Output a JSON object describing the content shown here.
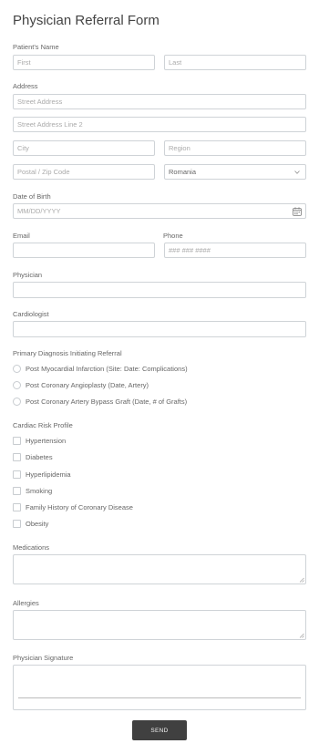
{
  "form": {
    "title": "Physician Referral Form",
    "patient_name": {
      "label": "Patient's Name",
      "first_placeholder": "First",
      "last_placeholder": "Last"
    },
    "address": {
      "label": "Address",
      "street_placeholder": "Street Address",
      "street2_placeholder": "Street Address Line 2",
      "city_placeholder": "City",
      "region_placeholder": "Region",
      "postal_placeholder": "Postal / Zip Code",
      "country_value": "Romania"
    },
    "dob": {
      "label": "Date of Birth",
      "placeholder": "MM/DD/YYYY"
    },
    "email": {
      "label": "Email"
    },
    "phone": {
      "label": "Phone",
      "placeholder": "### ### ####"
    },
    "physician": {
      "label": "Physician"
    },
    "cardiologist": {
      "label": "Cardiologist"
    },
    "diagnosis": {
      "label": "Primary Diagnosis Initiating Referral",
      "options": [
        "Post Myocardial Infarction (Site: Date: Complications)",
        "Post Coronary Angioplasty (Date, Artery)",
        "Post Coronary Artery Bypass Graft (Date, # of Grafts)"
      ]
    },
    "risk_profile": {
      "label": "Cardiac Risk Profile",
      "options": [
        "Hypertension",
        "Diabetes",
        "Hyperlipidemia",
        "Smoking",
        "Family History of Coronary Disease",
        "Obesity"
      ]
    },
    "medications": {
      "label": "Medications"
    },
    "allergies": {
      "label": "Allergies"
    },
    "signature": {
      "label": "Physician Signature"
    },
    "send_label": "SEND"
  },
  "icons": {
    "dropdown": "chevron-down-icon",
    "calendar": "calendar-icon",
    "resize": "resize-handle-icon"
  },
  "colors": {
    "border": "#cfd3d7",
    "button": "#404040",
    "text": "#666666"
  }
}
